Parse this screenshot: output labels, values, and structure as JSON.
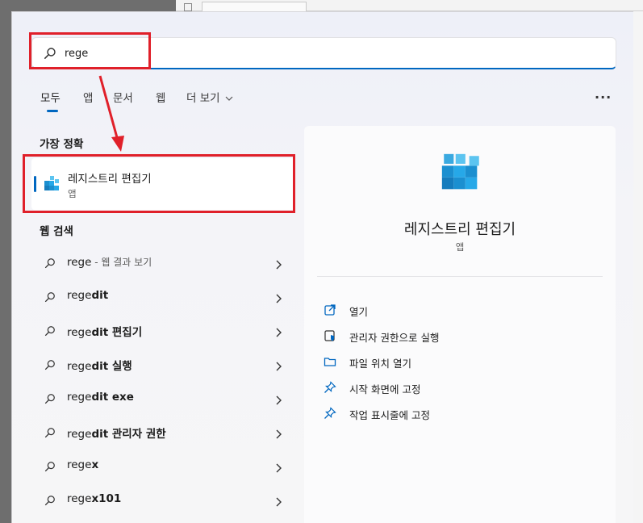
{
  "search": {
    "value": "rege",
    "placeholder": ""
  },
  "tabs": [
    {
      "label": "모두",
      "active": true
    },
    {
      "label": "앱",
      "active": false
    },
    {
      "label": "문서",
      "active": false
    },
    {
      "label": "웹",
      "active": false
    },
    {
      "label": "더 보기",
      "active": false
    }
  ],
  "more_label": "···",
  "best_match": {
    "section_title": "가장 정확",
    "title": "레지스트리 편집기",
    "subtitle": "앱"
  },
  "web_search": {
    "section_title": "웹 검색",
    "items": [
      {
        "light": "rege",
        "bold": "",
        "suffix": " - 웹 결과 보기"
      },
      {
        "light": "rege",
        "bold": "dit",
        "suffix": ""
      },
      {
        "light": "rege",
        "bold": "dit 편집기",
        "suffix": ""
      },
      {
        "light": "rege",
        "bold": "dit 실행",
        "suffix": ""
      },
      {
        "light": "rege",
        "bold": "dit exe",
        "suffix": ""
      },
      {
        "light": "rege",
        "bold": "dit 관리자 권한",
        "suffix": ""
      },
      {
        "light": "rege",
        "bold": "x",
        "suffix": ""
      },
      {
        "light": "rege",
        "bold": "x101",
        "suffix": ""
      }
    ]
  },
  "detail": {
    "title": "레지스트리 편집기",
    "subtitle": "앱",
    "actions": [
      {
        "label": "열기",
        "icon": "open-icon"
      },
      {
        "label": "관리자 권한으로 실행",
        "icon": "shield-icon"
      },
      {
        "label": "파일 위치 열기",
        "icon": "folder-icon"
      },
      {
        "label": "시작 화면에 고정",
        "icon": "pin-icon"
      },
      {
        "label": "작업 표시줄에 고정",
        "icon": "pin-icon"
      }
    ]
  },
  "colors": {
    "accent": "#0067c0",
    "highlight": "#e0202a",
    "icon_blue": "#1fa3e0"
  }
}
